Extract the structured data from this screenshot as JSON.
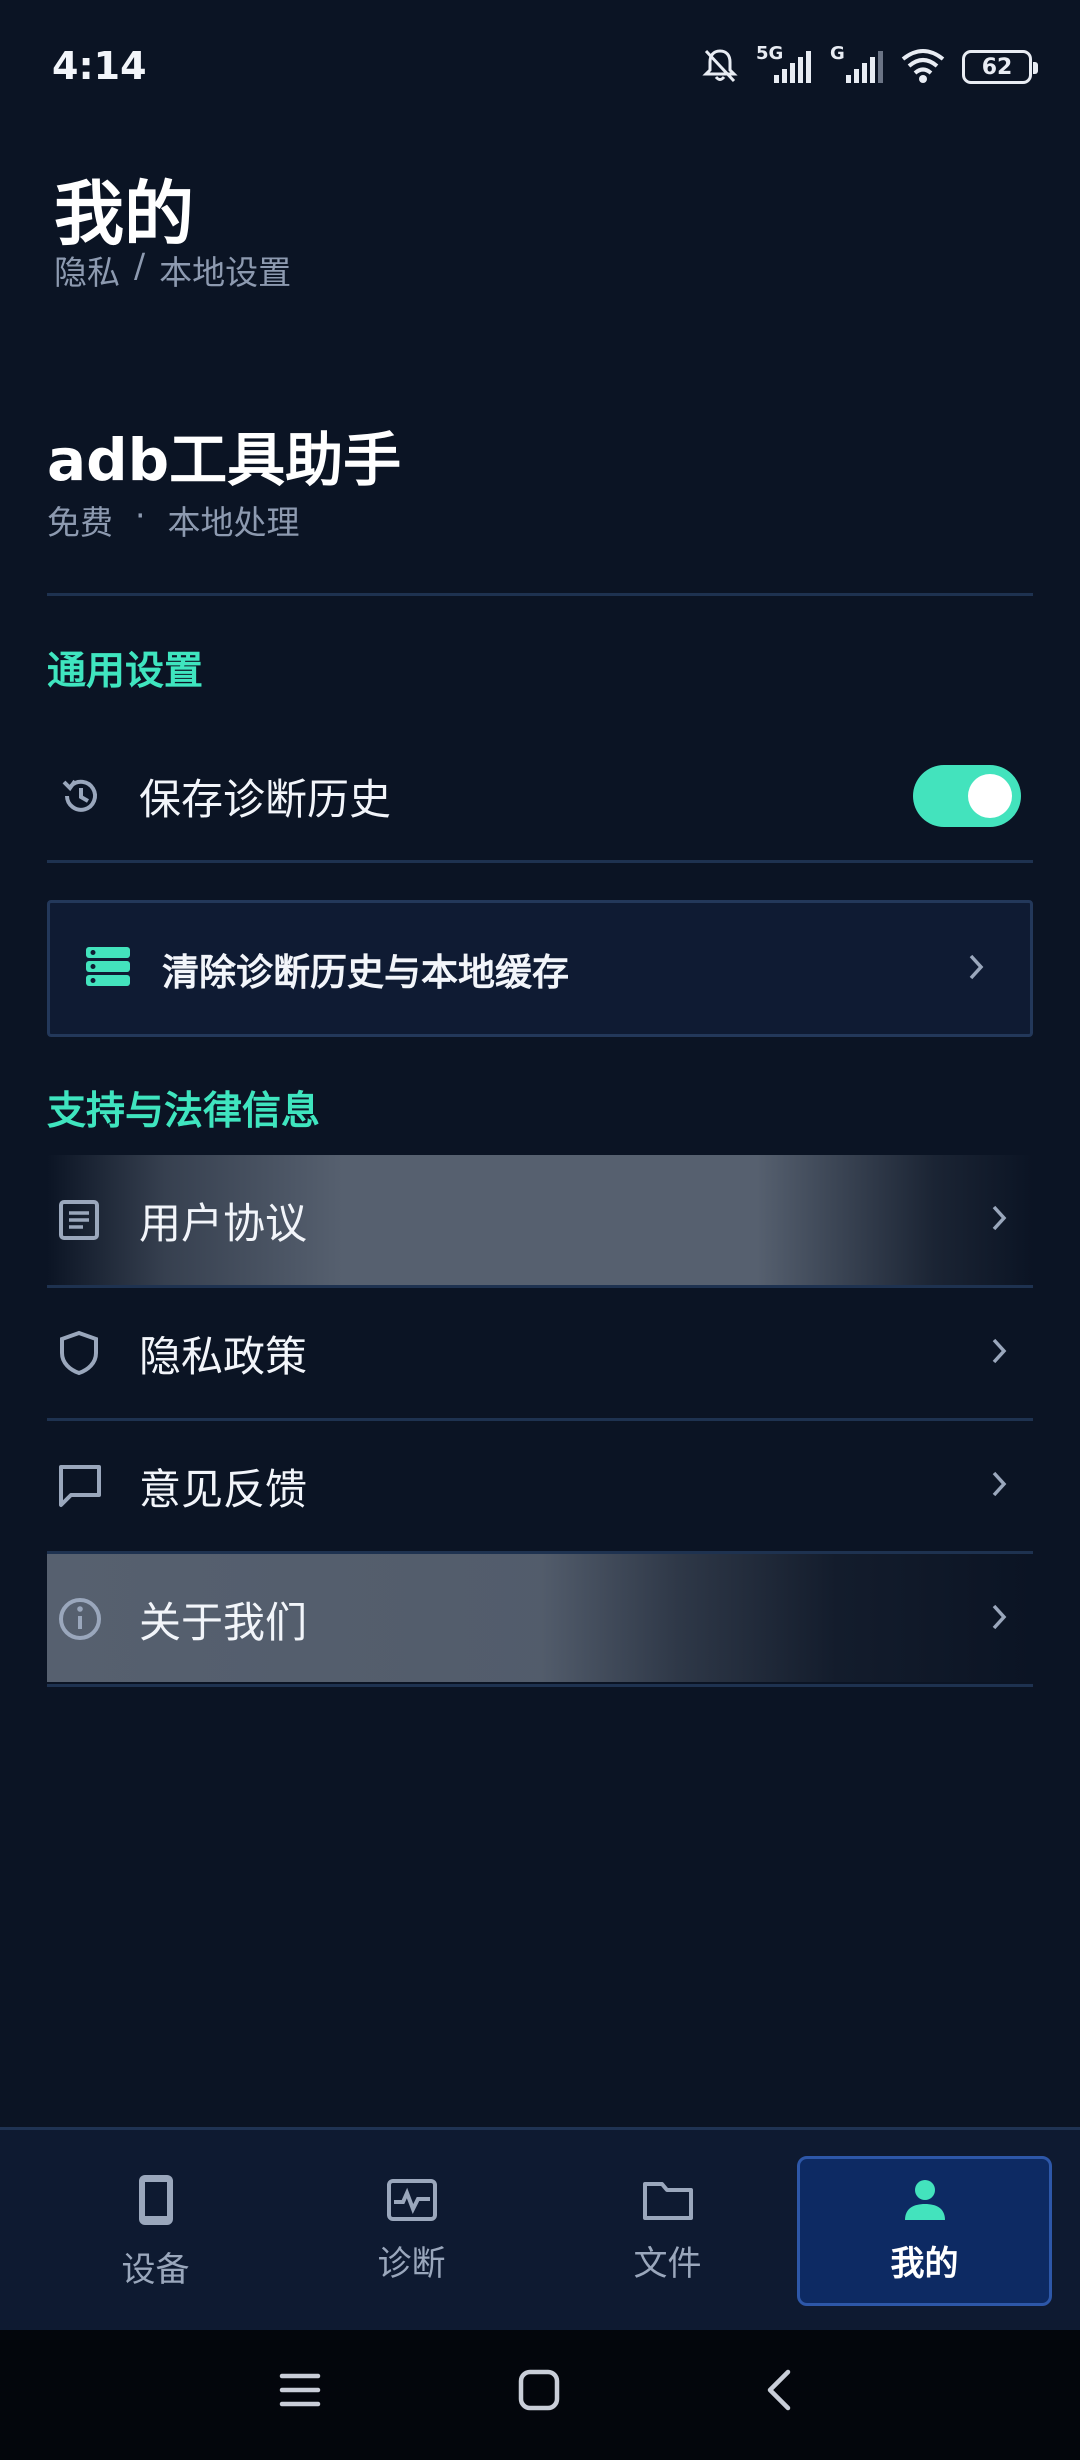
{
  "status_bar": {
    "time": "4:14",
    "network_1": "5G",
    "network_2": "G",
    "battery": "62"
  },
  "header": {
    "title": "我的",
    "breadcrumb": [
      "隐私",
      "/",
      "本地设置"
    ]
  },
  "app_info": {
    "name": "adb工具助手",
    "meta": [
      "免费",
      "·",
      "本地处理"
    ]
  },
  "general_settings": {
    "title": "通用设置",
    "save_history_label": "保存诊断历史",
    "save_history_enabled": true,
    "clear_label": "清除诊断历史与本地缓存"
  },
  "support": {
    "title": "支持与法律信息",
    "items": [
      {
        "label": "用户协议",
        "icon": "document-icon"
      },
      {
        "label": "隐私政策",
        "icon": "shield-icon"
      },
      {
        "label": "意见反馈",
        "icon": "message-icon"
      },
      {
        "label": "关于我们",
        "icon": "info-icon"
      }
    ]
  },
  "bottom_nav": {
    "items": [
      {
        "label": "设备",
        "icon": "phone-icon"
      },
      {
        "label": "诊断",
        "icon": "pulse-icon"
      },
      {
        "label": "文件",
        "icon": "folder-icon"
      },
      {
        "label": "我的",
        "icon": "person-icon",
        "active": true
      }
    ]
  },
  "colors": {
    "background": "#0b1424",
    "accent": "#3fe5bf",
    "active_nav": "#0d2a63"
  }
}
